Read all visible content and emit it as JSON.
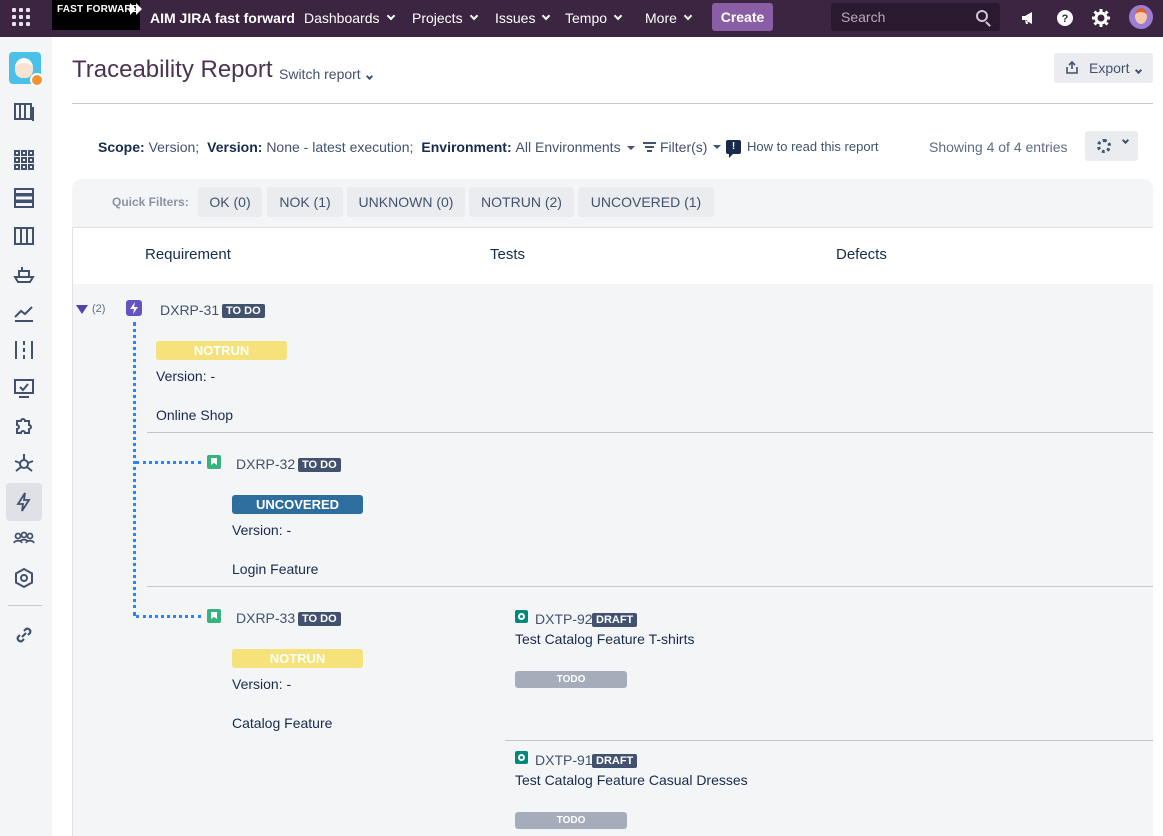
{
  "topnav": {
    "logo_text": "FAST FORWARD",
    "site_name": "AIM JIRA fast forward",
    "menus": [
      {
        "label": "Dashboards"
      },
      {
        "label": "Projects"
      },
      {
        "label": "Issues"
      },
      {
        "label": "Tempo"
      },
      {
        "label": "More"
      }
    ],
    "create_label": "Create",
    "search_placeholder": "Search"
  },
  "header": {
    "title": "Traceability Report",
    "switch_label": "Switch report",
    "export_label": "Export"
  },
  "filterbar": {
    "scope_label": "Scope:",
    "scope_value": "Version;",
    "version_label": "Version:",
    "version_value": "None - latest execution;",
    "env_label": "Environment:",
    "env_value": "All Environments",
    "filters_label": "Filter(s)",
    "howto_label": "How to read this report",
    "showing": "Showing 4 of 4 entries"
  },
  "quick_filters": {
    "label": "Quick Filters:",
    "items": [
      "OK (0)",
      "NOK (1)",
      "UNKNOWN (0)",
      "NOTRUN (2)",
      "UNCOVERED (1)"
    ]
  },
  "table": {
    "headers": [
      "Requirement",
      "Tests",
      "Defects"
    ],
    "expander": "(2)",
    "rows": [
      {
        "key": "DXRP-31",
        "status": "TO DO",
        "coverage": "NOTRUN",
        "version": "Version: -",
        "summary": "Online Shop"
      },
      {
        "key": "DXRP-32",
        "status": "TO DO",
        "coverage": "UNCOVERED",
        "version": "Version: -",
        "summary": "Login Feature"
      },
      {
        "key": "DXRP-33",
        "status": "TO DO",
        "coverage": "NOTRUN",
        "version": "Version: -",
        "summary": "Catalog Feature"
      }
    ],
    "tests": [
      {
        "key": "DXTP-92",
        "status": "DRAFT",
        "summary": "Test Catalog Feature T-shirts",
        "result": "TODO"
      },
      {
        "key": "DXTP-91",
        "status": "DRAFT",
        "summary": "Test Catalog Feature Casual Dresses",
        "result": "TODO"
      }
    ]
  },
  "colors": {
    "nav_bg": "#3b2540",
    "create_bg": "#8a5ea4",
    "notrun": "#f5e27a",
    "uncovered": "#2d6e9e",
    "todo": "#a5adba",
    "link_dots": "#2684ff"
  }
}
